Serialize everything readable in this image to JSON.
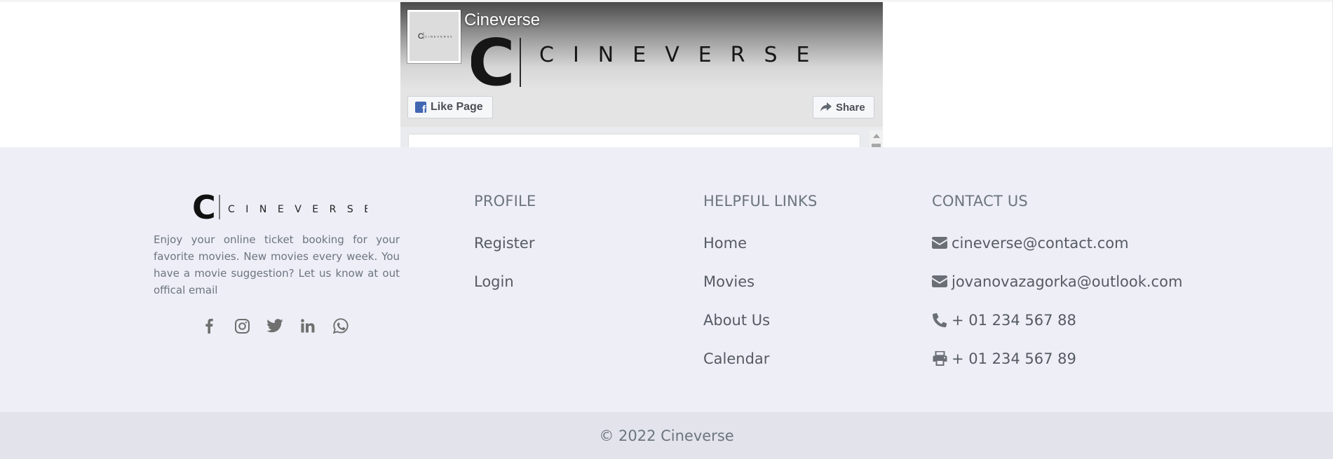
{
  "facebook_widget": {
    "page_name": "Cineverse",
    "like_button_label": "Like Page",
    "share_button_label": "Share",
    "cover_logo_letter": "C",
    "cover_logo_word": "CINEVERSE",
    "like_icon": "facebook-f-icon",
    "share_icon": "share-arrow-icon"
  },
  "footer": {
    "brand": {
      "logo_letter": "C",
      "logo_word": "CINEVERSE",
      "description": "Enjoy your online ticket booking for your favorite movies. New movies every week. You have a movie suggestion? Let us know at out offical email",
      "social_icons": [
        "facebook-icon",
        "instagram-icon",
        "twitter-icon",
        "linkedin-icon",
        "whatsapp-icon"
      ]
    },
    "profile": {
      "heading": "PROFILE",
      "links": [
        {
          "label": "Register"
        },
        {
          "label": "Login"
        }
      ]
    },
    "helpful_links": {
      "heading": "HELPFUL LINKS",
      "links": [
        {
          "label": "Home"
        },
        {
          "label": "Movies"
        },
        {
          "label": "About Us"
        },
        {
          "label": "Calendar"
        }
      ]
    },
    "contact": {
      "heading": "CONTACT US",
      "items": [
        {
          "icon": "envelope-icon",
          "text": "cineverse@contact.com"
        },
        {
          "icon": "envelope-icon",
          "text": "jovanovazagorka@outlook.com"
        },
        {
          "icon": "phone-icon",
          "text": "+ 01 234 567 88"
        },
        {
          "icon": "printer-icon",
          "text": "+ 01 234 567 89"
        }
      ]
    },
    "copyright": "© 2022 Cineverse"
  },
  "colors": {
    "footer_background": "#eeeef7",
    "copyright_background": "#e2e3eb",
    "muted_text": "#6c757d",
    "facebook_blue": "#4267b2"
  }
}
